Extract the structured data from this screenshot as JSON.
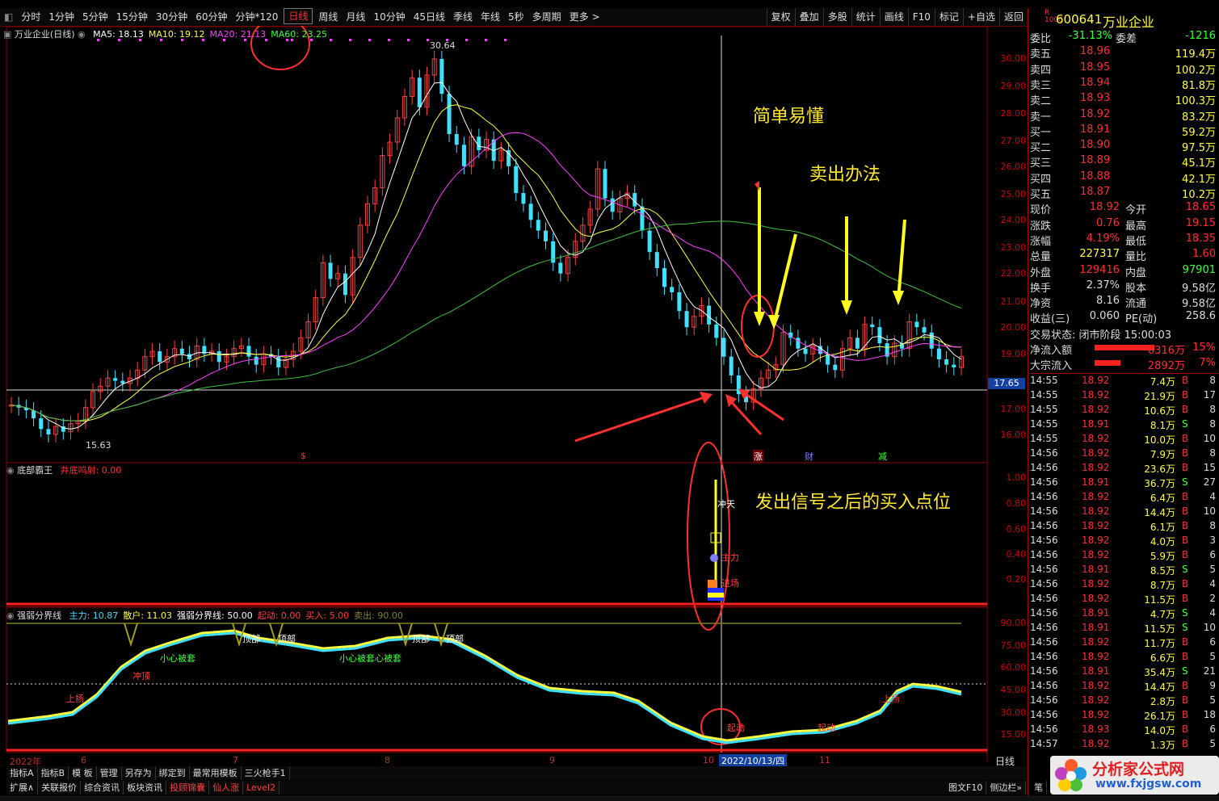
{
  "toolbar": {
    "timeframes": [
      "分时",
      "1分钟",
      "5分钟",
      "15分钟",
      "30分钟",
      "60分钟",
      "分钟*120",
      "日线",
      "周线",
      "月线",
      "10分钟",
      "45日线",
      "季线",
      "年线",
      "5秒",
      "多周期",
      "更多 >"
    ],
    "active": "日线",
    "right_buttons": [
      "复权",
      "叠加",
      "多股",
      "统计",
      "画线",
      "F10",
      "标记",
      "+自选",
      "返回"
    ]
  },
  "main_panel": {
    "title": "万业企业(日线)",
    "ma": [
      {
        "label": "MA5: 18.13",
        "color": "#ffffff"
      },
      {
        "label": "MA10: 19.12",
        "color": "#ffff40"
      },
      {
        "label": "MA20: 21.13",
        "color": "#ff40ff"
      },
      {
        "label": "MA60: 23.25",
        "color": "#40ff40"
      }
    ],
    "price_axis": [
      "30.00",
      "29.00",
      "28.00",
      "27.00",
      "26.00",
      "25.00",
      "24.00",
      "23.00",
      "22.00",
      "21.00",
      "20.00",
      "19.00",
      "17.00",
      "16.00"
    ],
    "high_label": "30.64",
    "low_label": "15.63",
    "cursor_price": "17.65",
    "markers": {
      "m1": "$",
      "m2": "涨",
      "m3": "财",
      "m4": "减"
    }
  },
  "panel2": {
    "title": "底部霸王",
    "param": "井底鸣射: 0.00",
    "axis": [
      "1.00",
      "0.80",
      "0.60",
      "0.40",
      "0.20"
    ],
    "labels": {
      "a": "冲天",
      "b": "主力",
      "c": "进场",
      "d": "资金"
    }
  },
  "panel3": {
    "title": "强弱分界线",
    "items": [
      {
        "label": "主力: 10.87",
        "color": "#40e0ff"
      },
      {
        "label": "散户: 11.03",
        "color": "#ffff40"
      },
      {
        "label": "强弱分界线: 50.00",
        "color": "#ffffff"
      },
      {
        "label": "起动: 0.00",
        "color": "#ff4040"
      },
      {
        "label": "买入: 5.00",
        "color": "#ff4040"
      },
      {
        "label": "卖出: 90.00",
        "color": "#808040"
      }
    ],
    "axis": [
      "90.00",
      "75.00",
      "60.00",
      "45.00",
      "30.00",
      "15.00"
    ],
    "texts": {
      "t1": "小心被套",
      "t2": "小心被套心被套",
      "t3": "冲顶",
      "t4": "上扬",
      "t5": "顶部",
      "t6": "顶部",
      "t7": "顶部",
      "t8": "顶部",
      "t9": "起动",
      "t10": "起动",
      "t11": "上扬"
    }
  },
  "x_axis": {
    "labels": [
      "2022年",
      "6",
      "7",
      "8",
      "9",
      "10",
      "11"
    ],
    "cursor_date": "2022/10/13/四",
    "period": "日线"
  },
  "annotations": {
    "a1": "简单易懂",
    "a2": "卖出办法",
    "a3": "发出信号之后的买入点位"
  },
  "bottom_tabs_row1": [
    "指标A",
    "指标B",
    "模 板",
    "管理",
    "另存为",
    "绑定到",
    "最常用模板",
    "三火枪手1"
  ],
  "bottom_tabs_row2": [
    "扩展∧",
    "关联报价",
    "综合资讯",
    "板块资讯",
    "投顾锦囊",
    "仙人涨",
    "Level2"
  ],
  "bottom_right": [
    "图文F10",
    "侧边栏»",
    "笔"
  ],
  "watermark": {
    "name": "分析家公式网",
    "url": "www.fxjgsw.com"
  },
  "quote": {
    "code": "600641",
    "name": "万业企业",
    "weibi_label": "委比",
    "weibi": "-31.13%",
    "weicha_label": "委差",
    "weicha": "-1216",
    "asks": [
      {
        "label": "卖五",
        "price": "18.96",
        "vol": "119.4万"
      },
      {
        "label": "卖四",
        "price": "18.95",
        "vol": "100.2万"
      },
      {
        "label": "卖三",
        "price": "18.94",
        "vol": "81.8万"
      },
      {
        "label": "卖二",
        "price": "18.93",
        "vol": "100.3万"
      },
      {
        "label": "卖一",
        "price": "18.92",
        "vol": "83.2万"
      }
    ],
    "bids": [
      {
        "label": "买一",
        "price": "18.91",
        "vol": "59.2万"
      },
      {
        "label": "买二",
        "price": "18.90",
        "vol": "97.5万"
      },
      {
        "label": "买三",
        "price": "18.89",
        "vol": "45.1万"
      },
      {
        "label": "买四",
        "price": "18.88",
        "vol": "42.1万"
      },
      {
        "label": "买五",
        "price": "18.87",
        "vol": "10.2万"
      }
    ],
    "stats": [
      {
        "l1": "现价",
        "v1": "18.92",
        "l2": "今开",
        "v2": "18.65",
        "c1": "#ff3030",
        "c2": "#ff3030"
      },
      {
        "l1": "涨跌",
        "v1": "0.76",
        "l2": "最高",
        "v2": "19.15",
        "c1": "#ff3030",
        "c2": "#ff3030"
      },
      {
        "l1": "涨幅",
        "v1": "4.19%",
        "l2": "最低",
        "v2": "18.35",
        "c1": "#ff3030",
        "c2": "#ff3030"
      },
      {
        "l1": "总量",
        "v1": "227317",
        "l2": "量比",
        "v2": "1.60",
        "c1": "#ffff40",
        "c2": "#ff3030"
      },
      {
        "l1": "外盘",
        "v1": "129416",
        "l2": "内盘",
        "v2": "97901",
        "c1": "#ff3030",
        "c2": "#40ff40"
      }
    ],
    "fin": [
      {
        "l1": "换手",
        "v1": "2.37%",
        "l2": "股本",
        "v2": "9.58亿"
      },
      {
        "l1": "净资",
        "v1": "8.16",
        "l2": "流通",
        "v2": "9.58亿"
      },
      {
        "l1": "收益(三)",
        "v1": "0.060",
        "l2": "PE(动)",
        "v2": "258.6"
      }
    ],
    "trade_state": "交易状态: 闭市阶段 15:00:03",
    "flows": [
      {
        "label": "净流入额",
        "value": "6316万",
        "pct": "15%",
        "fill": 0.8
      },
      {
        "label": "大宗流入",
        "value": "2892万",
        "pct": "7%",
        "fill": 0.35
      }
    ],
    "ticks": [
      {
        "t": "14:55",
        "p": "18.92",
        "v": "7.4万",
        "s": "B",
        "n": "8"
      },
      {
        "t": "14:55",
        "p": "18.92",
        "v": "21.9万",
        "s": "B",
        "n": "17"
      },
      {
        "t": "14:55",
        "p": "18.92",
        "v": "10.6万",
        "s": "B",
        "n": "8"
      },
      {
        "t": "14:55",
        "p": "18.91",
        "v": "8.1万",
        "s": "S",
        "n": "8"
      },
      {
        "t": "14:55",
        "p": "18.92",
        "v": "10.0万",
        "s": "B",
        "n": "10"
      },
      {
        "t": "14:56",
        "p": "18.92",
        "v": "7.9万",
        "s": "B",
        "n": "8"
      },
      {
        "t": "14:56",
        "p": "18.92",
        "v": "23.6万",
        "s": "B",
        "n": "15"
      },
      {
        "t": "14:56",
        "p": "18.91",
        "v": "36.7万",
        "s": "S",
        "n": "27"
      },
      {
        "t": "14:56",
        "p": "18.92",
        "v": "6.4万",
        "s": "B",
        "n": "4"
      },
      {
        "t": "14:56",
        "p": "18.92",
        "v": "14.4万",
        "s": "B",
        "n": "10"
      },
      {
        "t": "14:56",
        "p": "18.92",
        "v": "6.1万",
        "s": "B",
        "n": "8"
      },
      {
        "t": "14:56",
        "p": "18.92",
        "v": "4.0万",
        "s": "B",
        "n": "3"
      },
      {
        "t": "14:56",
        "p": "18.92",
        "v": "5.9万",
        "s": "B",
        "n": "6"
      },
      {
        "t": "14:56",
        "p": "18.91",
        "v": "8.5万",
        "s": "S",
        "n": "5"
      },
      {
        "t": "14:56",
        "p": "18.92",
        "v": "8.7万",
        "s": "B",
        "n": "4"
      },
      {
        "t": "14:56",
        "p": "18.92",
        "v": "11.5万",
        "s": "B",
        "n": "2"
      },
      {
        "t": "14:56",
        "p": "18.91",
        "v": "4.7万",
        "s": "S",
        "n": "4"
      },
      {
        "t": "14:56",
        "p": "18.91",
        "v": "11.5万",
        "s": "S",
        "n": "10"
      },
      {
        "t": "14:56",
        "p": "18.92",
        "v": "11.7万",
        "s": "B",
        "n": "6"
      },
      {
        "t": "14:56",
        "p": "18.92",
        "v": "6.6万",
        "s": "B",
        "n": "5"
      },
      {
        "t": "14:56",
        "p": "18.91",
        "v": "35.4万",
        "s": "S",
        "n": "21"
      },
      {
        "t": "14:56",
        "p": "18.92",
        "v": "14.4万",
        "s": "B",
        "n": "9"
      },
      {
        "t": "14:56",
        "p": "18.92",
        "v": "2.8万",
        "s": "B",
        "n": "5"
      },
      {
        "t": "14:56",
        "p": "18.92",
        "v": "26.1万",
        "s": "B",
        "n": "18"
      },
      {
        "t": "14:56",
        "p": "18.93",
        "v": "14.0万",
        "s": "B",
        "n": "6"
      },
      {
        "t": "14:57",
        "p": "18.92",
        "v": "1.3万",
        "s": "B",
        "n": "5"
      }
    ]
  }
}
